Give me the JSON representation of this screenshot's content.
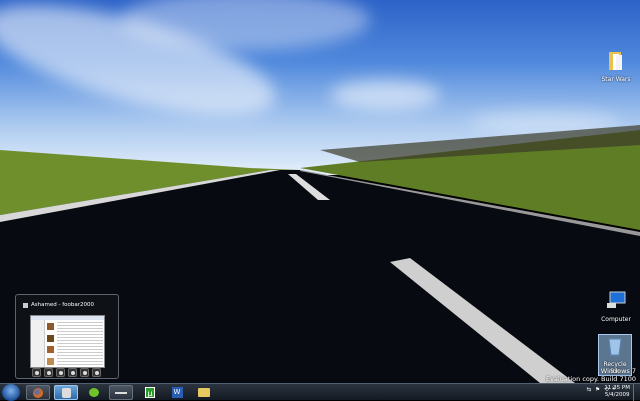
{
  "desktop": {
    "icons": [
      {
        "label": "Star Wars",
        "icon": "folder-icon"
      },
      {
        "label": "Computer",
        "icon": "computer-icon"
      },
      {
        "label": "Recycle Bin",
        "icon": "recycle-bin-icon",
        "selected": true
      }
    ],
    "watermark": {
      "line1": "Windows 7",
      "line2": "Evaluation copy. Build 7100"
    }
  },
  "preview": {
    "title": "Ashamed - foobar2000",
    "controls": [
      "stop",
      "pause",
      "play",
      "previous",
      "next",
      "random"
    ]
  },
  "taskbar": {
    "items": [
      {
        "name": "firefox",
        "icon": "firefox-icon"
      },
      {
        "name": "foobar2000",
        "icon": "foobar-icon",
        "active": true
      },
      {
        "name": "green app",
        "icon": "green-app-icon"
      },
      {
        "name": "steam-like app",
        "icon": "app-icon"
      },
      {
        "name": "uTorrent",
        "icon": "utorrent-icon",
        "glyph": "µ"
      },
      {
        "name": "Word",
        "icon": "word-icon",
        "glyph": "W"
      },
      {
        "name": "Windows Explorer",
        "icon": "explorer-folder-icon"
      }
    ],
    "clock": {
      "time": "11:35 PM",
      "date": "5/4/2009"
    }
  },
  "colors": {
    "sky": "#4f88dc",
    "taskbar": "#1c232c",
    "active": "#4a8ac8"
  }
}
